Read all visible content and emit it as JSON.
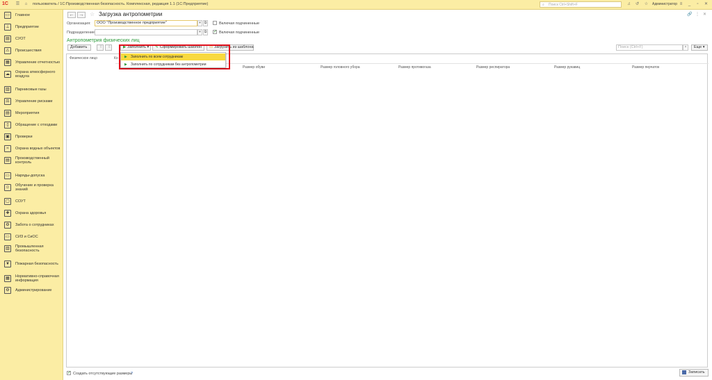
{
  "titlebar": {
    "logo": "1С",
    "title": "пользователь / 1С:Производственная безопасность. Комплексная, редакция 1.1  (1С:Предприятие)",
    "search_placeholder": "Поиск Ctrl+Shift+F",
    "user": "Администратор"
  },
  "sidebar": {
    "items": [
      {
        "label": "Главное",
        "icon": "home-icon",
        "glyph": "▭"
      },
      {
        "label": "Предприятие",
        "icon": "org-structure-icon",
        "glyph": "⊥"
      },
      {
        "label": "СУОТ",
        "icon": "suot-icon",
        "glyph": "▤"
      },
      {
        "label": "Происшествия",
        "icon": "warning-icon",
        "glyph": "⚠"
      },
      {
        "label": "Управление отчетностью",
        "icon": "reports-icon",
        "glyph": "▦"
      },
      {
        "label": "Охрана атмосферного воздуха",
        "icon": "air-icon",
        "glyph": "☁"
      },
      {
        "label": "Парниковые газы",
        "icon": "gas-icon",
        "glyph": "▥"
      },
      {
        "label": "Управление рисками",
        "icon": "risk-icon",
        "glyph": "⚖"
      },
      {
        "label": "Мероприятия",
        "icon": "events-icon",
        "glyph": "▤"
      },
      {
        "label": "Обращение с отходами",
        "icon": "waste-icon",
        "glyph": "▯"
      },
      {
        "label": "Проверки",
        "icon": "checks-icon",
        "glyph": "▣"
      },
      {
        "label": "Охрана водных объектов",
        "icon": "water-icon",
        "glyph": "≈"
      },
      {
        "label": "Производственный контроль",
        "icon": "control-icon",
        "glyph": "▤"
      },
      {
        "label": "Наряды-допуска",
        "icon": "permits-icon",
        "glyph": "▭"
      },
      {
        "label": "Обучение и проверка знаний",
        "icon": "training-icon",
        "glyph": "☺"
      },
      {
        "label": "СОУТ",
        "icon": "sout-icon",
        "glyph": "▢"
      },
      {
        "label": "Охрана здоровья",
        "icon": "health-icon",
        "glyph": "✚"
      },
      {
        "label": "Забота о сотрудниках",
        "icon": "care-icon",
        "glyph": "⚙"
      },
      {
        "label": "СИЗ и СиОС",
        "icon": "ppe-icon",
        "glyph": "▭"
      },
      {
        "label": "Промышленная безопасность",
        "icon": "industrial-icon",
        "glyph": "▥"
      },
      {
        "label": "Пожарная безопасность",
        "icon": "fire-icon",
        "glyph": "▼"
      },
      {
        "label": "Нормативно-справочная информация",
        "icon": "reference-icon",
        "glyph": "▦"
      },
      {
        "label": "Администрирование",
        "icon": "admin-icon",
        "glyph": "⚙"
      }
    ]
  },
  "main": {
    "title": "Загрузка антропометрии",
    "org_label": "Организация:",
    "org_value": "ООО \"Производственное предприятие\"",
    "org_sub_label": "Включая подчиненные",
    "dept_label": "Подразделение:",
    "dept_value": "",
    "dept_sub_label": "Включая подчиненные",
    "section_title": "Антропометрия физических лиц",
    "toolbar": {
      "add": "Добавить",
      "up": "⇧",
      "down": "⇩",
      "fill": "Заполнить",
      "form_template": "Сформировать шаблон",
      "load_template": "Загрузить из шаблона",
      "search_placeholder": "Поиск (Ctrl+F)",
      "more": "Еще"
    },
    "dropdown": {
      "items": [
        "Заполнить по всем сотрудникам",
        "Заполнить по сотрудникам без антропометрии"
      ]
    },
    "table": {
      "columns": [
        "Физическое лицо",
        "Ко",
        "Размер обуви",
        "Размер головного убора",
        "Размер противогаза",
        "Размер респиратора",
        "Размер рукавиц",
        "Размер перчаток"
      ]
    },
    "footer": {
      "create_missing": "Создать отсутствующие размеры",
      "help": "?",
      "save": "Записать"
    }
  }
}
